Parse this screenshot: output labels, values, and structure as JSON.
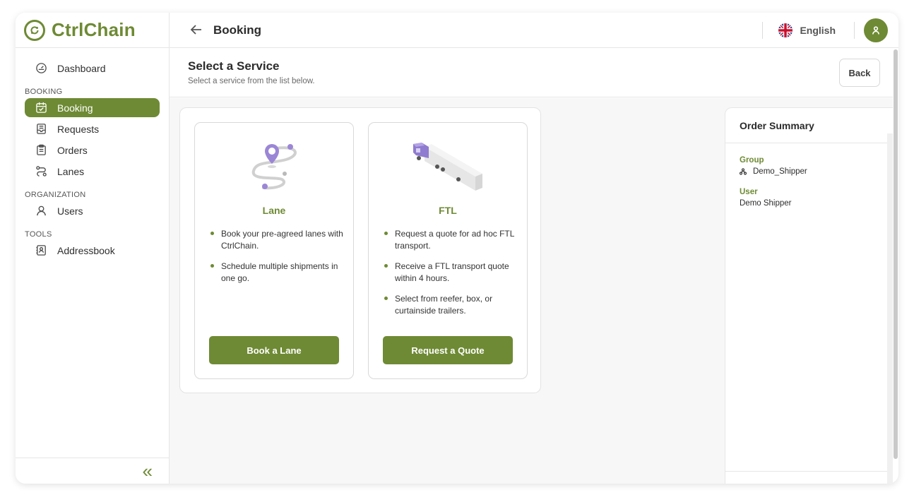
{
  "brand": {
    "name": "CtrlChain",
    "accent": "#6e8a34"
  },
  "sidebar": {
    "dashboard": "Dashboard",
    "sections": [
      {
        "title": "BOOKING",
        "items": [
          "Booking",
          "Requests",
          "Orders",
          "Lanes"
        ]
      },
      {
        "title": "ORGANIZATION",
        "items": [
          "Users"
        ]
      },
      {
        "title": "TOOLS",
        "items": [
          "Addressbook"
        ]
      }
    ],
    "active": "Booking",
    "collapse_icon": "double-chevron-left-icon"
  },
  "topbar": {
    "title": "Booking",
    "language": "English"
  },
  "content": {
    "title": "Select a Service",
    "subtitle": "Select a service from the list below.",
    "back_label": "Back"
  },
  "services": [
    {
      "title": "Lane",
      "bullets": [
        "Book your pre-agreed lanes with CtrlChain.",
        "Schedule multiple shipments in one go."
      ],
      "button": "Book a Lane"
    },
    {
      "title": "FTL",
      "bullets": [
        "Request a quote for ad hoc FTL transport.",
        "Receive a FTL transport quote within 4 hours.",
        "Select from reefer, box, or curtainside trailers."
      ],
      "button": "Request a Quote"
    }
  ],
  "summary": {
    "title": "Order Summary",
    "group_label": "Group",
    "group_value": "Demo_Shipper",
    "user_label": "User",
    "user_value": "Demo Shipper"
  }
}
